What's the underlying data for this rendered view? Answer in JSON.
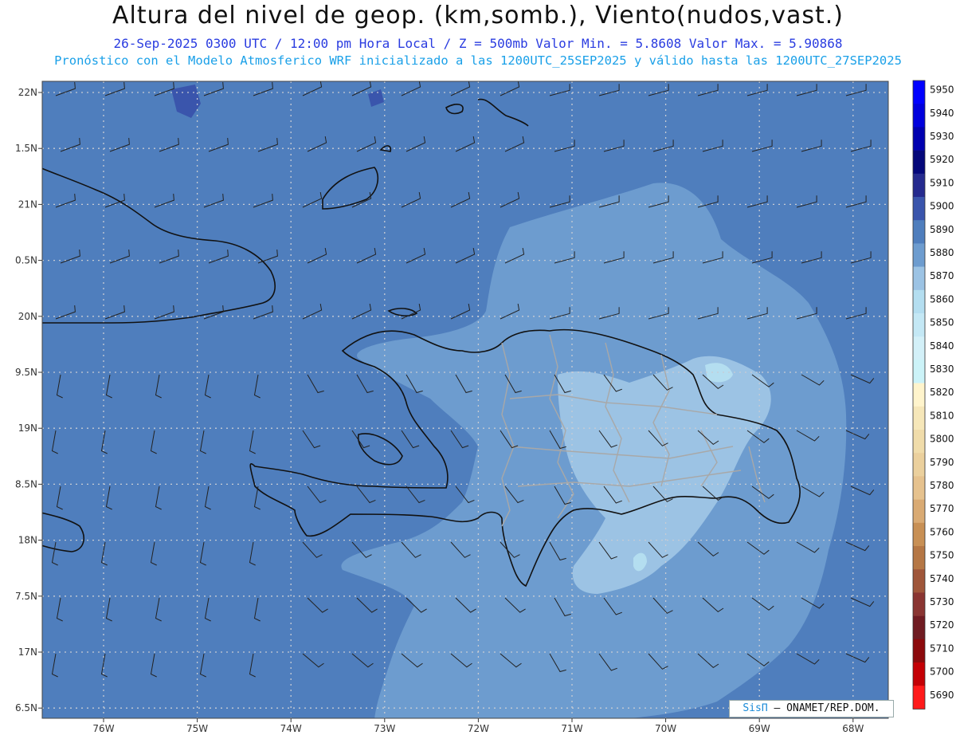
{
  "title": "Altura del nivel de geop. (km,somb.), Viento(nudos,vast.)",
  "subtitle_1": "26-Sep-2025  0300 UTC / 12:00 pm Hora Local / Z = 500mb    Valor Min. = 5.8608  Valor Max. = 5.90868",
  "subtitle_2": "Pronóstico con el Modelo Atmosferico WRF inicializado a las 1200UTC_25SEP2025 y válido hasta las  1200UTC_27SEP2025",
  "credit": {
    "brand": "SisΠ",
    "text": "– ONAMET/REP.DOM."
  },
  "latitude_labels": [
    "22N",
    "1.5N",
    "21N",
    "0.5N",
    "20N",
    "9.5N",
    "19N",
    "8.5N",
    "18N",
    "7.5N",
    "17N",
    "6.5N"
  ],
  "longitude_labels": [
    "76W",
    "75W",
    "74W",
    "73W",
    "72W",
    "71W",
    "70W",
    "69W",
    "68W"
  ],
  "colorbar": {
    "levels": [
      "5950",
      "5940",
      "5930",
      "5920",
      "5910",
      "5900",
      "5890",
      "5880",
      "5870",
      "5860",
      "5850",
      "5840",
      "5830",
      "5820",
      "5810",
      "5800",
      "5790",
      "5780",
      "5770",
      "5760",
      "5750",
      "5740",
      "5730",
      "5720",
      "5710",
      "5700",
      "5690"
    ],
    "colors": [
      "#0000ff",
      "#0000dd",
      "#0000b0",
      "#05087a",
      "#252a8e",
      "#3a55ac",
      "#4f7ebd",
      "#6d9ccf",
      "#9cc3e4",
      "#b4def0",
      "#c4e8f5",
      "#d3f0f8",
      "#ccf3f8",
      "#fff4cc",
      "#f6e7b9",
      "#f0dcaa",
      "#ebd09d",
      "#e6c28e",
      "#d9aa73",
      "#c89055",
      "#b57745",
      "#9f563a",
      "#8a3532",
      "#701c22",
      "#8c0a0c",
      "#c40005",
      "#ff1a1a"
    ]
  },
  "fill_colors": {
    "level_5900": "#3a55ac",
    "level_5890": "#4f7ebd",
    "level_5880": "#6d9ccf",
    "level_5870": "#9cc3e4",
    "level_5860": "#b4def0"
  }
}
